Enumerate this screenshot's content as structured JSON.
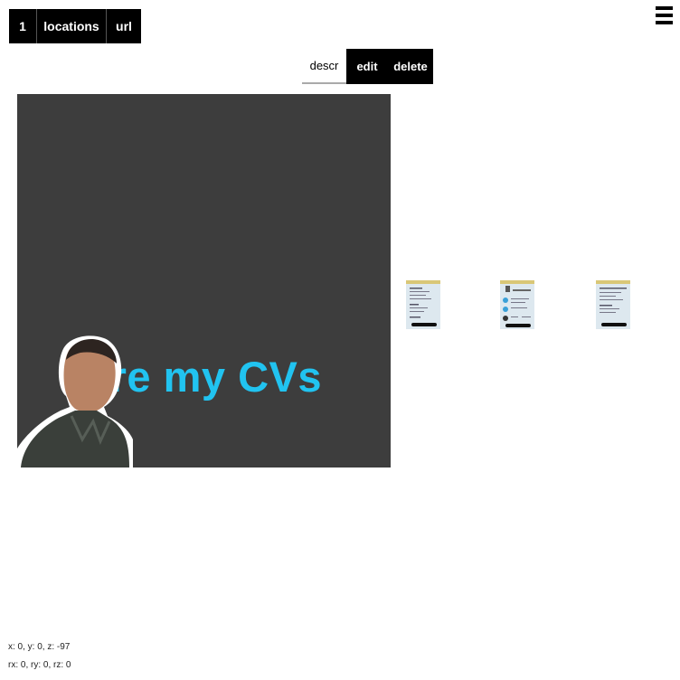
{
  "nav": {
    "number": "1",
    "locations": "locations",
    "url": "url"
  },
  "toolbar": {
    "descr": "descr",
    "edit": "edit",
    "delete": "delete"
  },
  "card": {
    "title": "are my CVs",
    "title_color": "#21c3f0",
    "background": "#3d3d3d"
  },
  "thumbnails": [
    "cv-thumbnail",
    "cv-thumbnail",
    "cv-thumbnail"
  ],
  "status": {
    "position": "x: 0, y: 0, z: -97",
    "rotation": "rx: 0, ry: 0, rz: 0"
  },
  "icons": {
    "menu": "hamburger-menu-icon"
  }
}
